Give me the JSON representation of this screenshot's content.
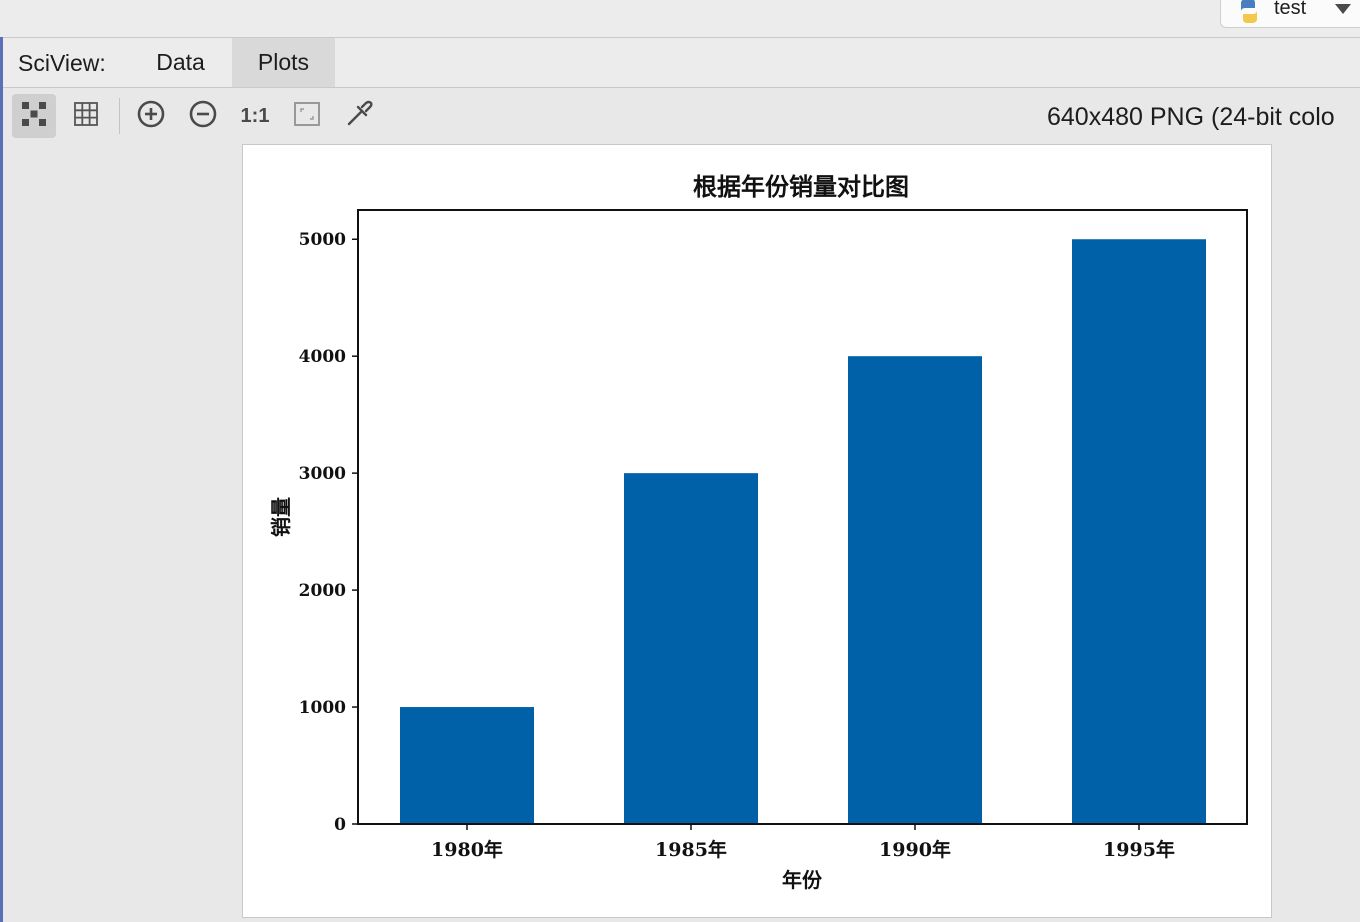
{
  "run_config": {
    "label": "test",
    "icon": "python-icon",
    "dropdown_icon": "chevron-down-icon"
  },
  "sciview": {
    "prefix": "SciView:",
    "tabs": [
      {
        "label": "Data",
        "selected": false
      },
      {
        "label": "Plots",
        "selected": true
      }
    ]
  },
  "toolbar": {
    "buttons": [
      {
        "name": "thumbnails-view-button",
        "icon": "thumbnails-icon",
        "active": true
      },
      {
        "name": "grid-view-button",
        "icon": "grid-icon",
        "active": false
      },
      {
        "name": "zoom-in-button",
        "icon": "zoom-in-icon",
        "active": false
      },
      {
        "name": "zoom-out-button",
        "icon": "zoom-out-icon",
        "active": false
      },
      {
        "name": "actual-size-button",
        "icon": "one-to-one-icon",
        "label": "1:1",
        "active": false
      },
      {
        "name": "fit-to-window-button",
        "icon": "fit-window-icon",
        "active": false
      },
      {
        "name": "color-picker-button",
        "icon": "eyedropper-icon",
        "active": false
      }
    ],
    "image_info": "640x480 PNG (24-bit colo"
  },
  "chart_data": {
    "type": "bar",
    "title": "根据年份销量对比图",
    "xlabel": "年份",
    "ylabel": "销量",
    "categories": [
      "1980年",
      "1985年",
      "1990年",
      "1995年"
    ],
    "values": [
      1000,
      3000,
      4000,
      5000
    ],
    "ylim": [
      0,
      5250
    ],
    "yticks": [
      0,
      1000,
      2000,
      3000,
      4000,
      5000
    ],
    "bar_color": "#0060a8",
    "grid": false
  }
}
